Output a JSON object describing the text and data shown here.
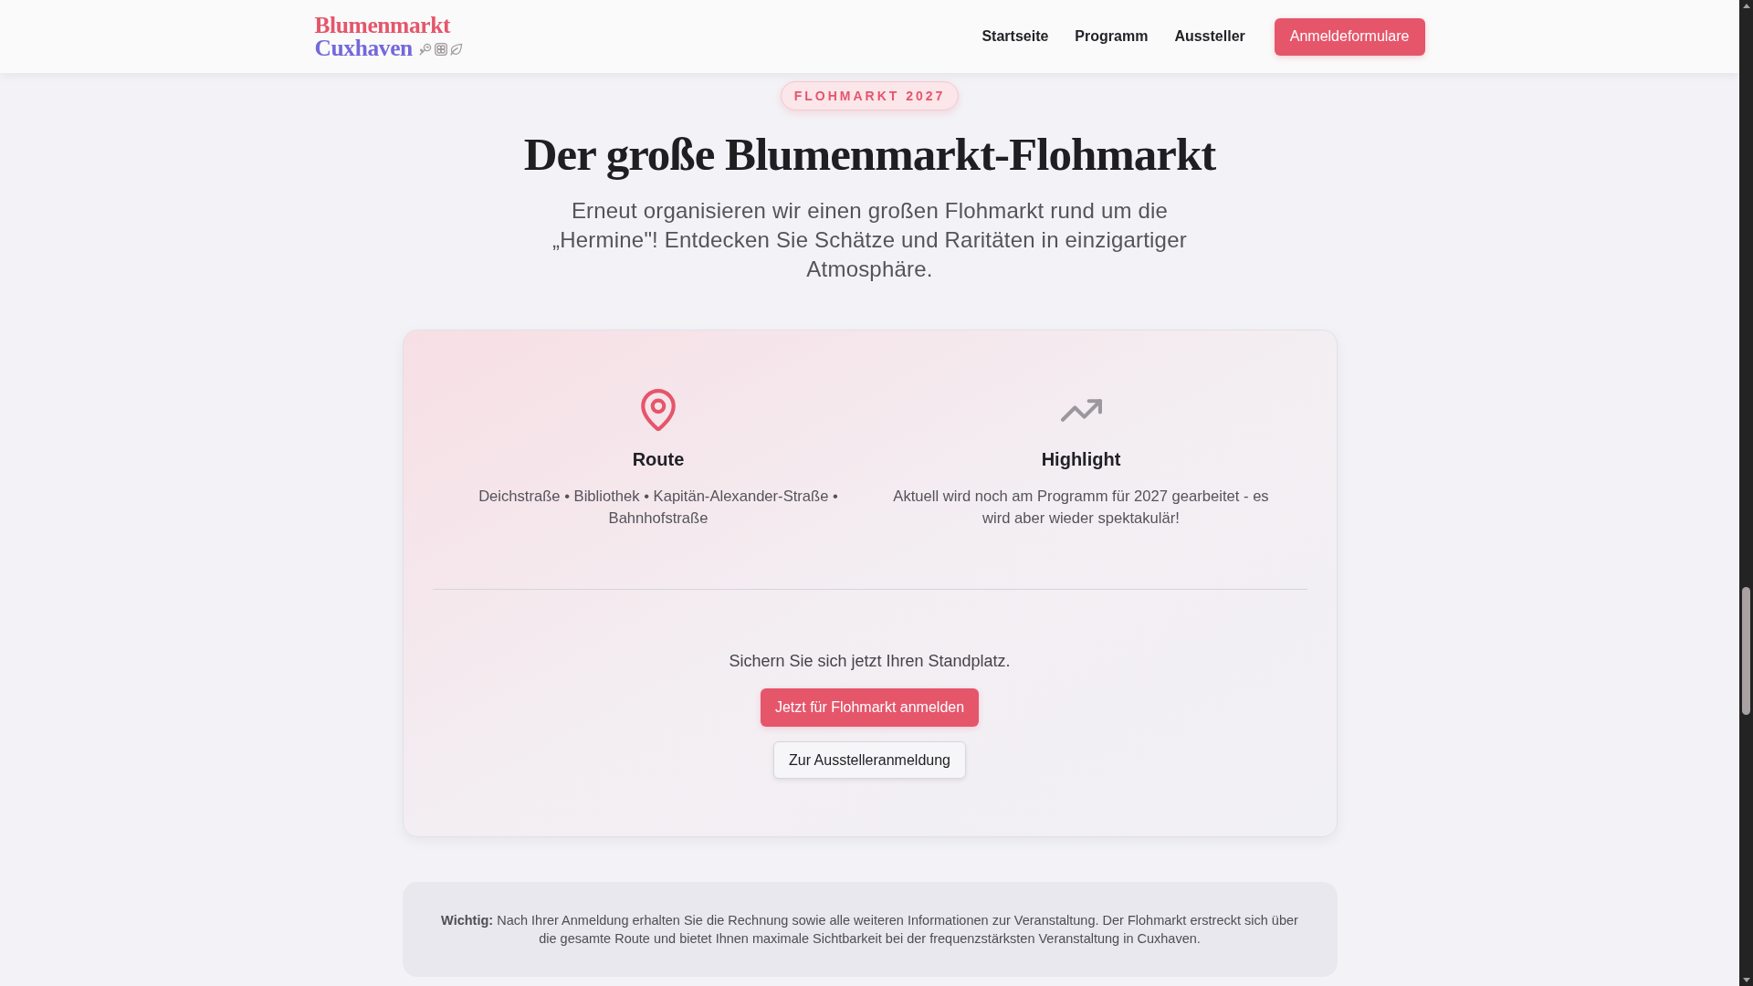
{
  "header": {
    "logo": {
      "line_1": "Blumenmarkt",
      "line_2": "Cuxhaven"
    },
    "nav": [
      "Startseite",
      "Programm",
      "Aussteller"
    ],
    "cta": "Anmeldeformulare"
  },
  "hero": {
    "badge": "FLOHMARKT 2027",
    "title": "Der große Blumenmarkt-Flohmarkt",
    "subtitle": "Erneut organisieren wir einen großen Flohmarkt rund um die „Hermine\"! Entdecken Sie Schätze und Raritäten in einzigartiger Atmosphäre."
  },
  "card": {
    "features": [
      {
        "title": "Route",
        "text": "Deichstraße • Bibliothek • Kapitän-Alexander-Straße • Bahnhofstraße"
      },
      {
        "title": "Highlight",
        "text": "Aktuell wird noch am Programm für 2027 gearbeitet - es wird aber wieder spektakulär!"
      }
    ],
    "prompt": "Sichern Sie sich jetzt Ihren Standplatz.",
    "buttons": [
      {
        "label": "Jetzt für Flohmarkt anmelden",
        "kind": "primary"
      },
      {
        "label": "Zur Ausstelleranmeldung",
        "kind": "secondary"
      }
    ]
  },
  "note": {
    "text": "**Wichtig:** Nach Ihrer Anmeldung erhalten Sie die Rechnung sowie alle weiteren Informationen zur Veranstaltung. Der Flohmarkt erstreckt sich über die gesamte Route und bietet Ihnen maximale Sichtbarkeit bei der frequenzstärksten Veranstaltung in Cuxhaven."
  }
}
